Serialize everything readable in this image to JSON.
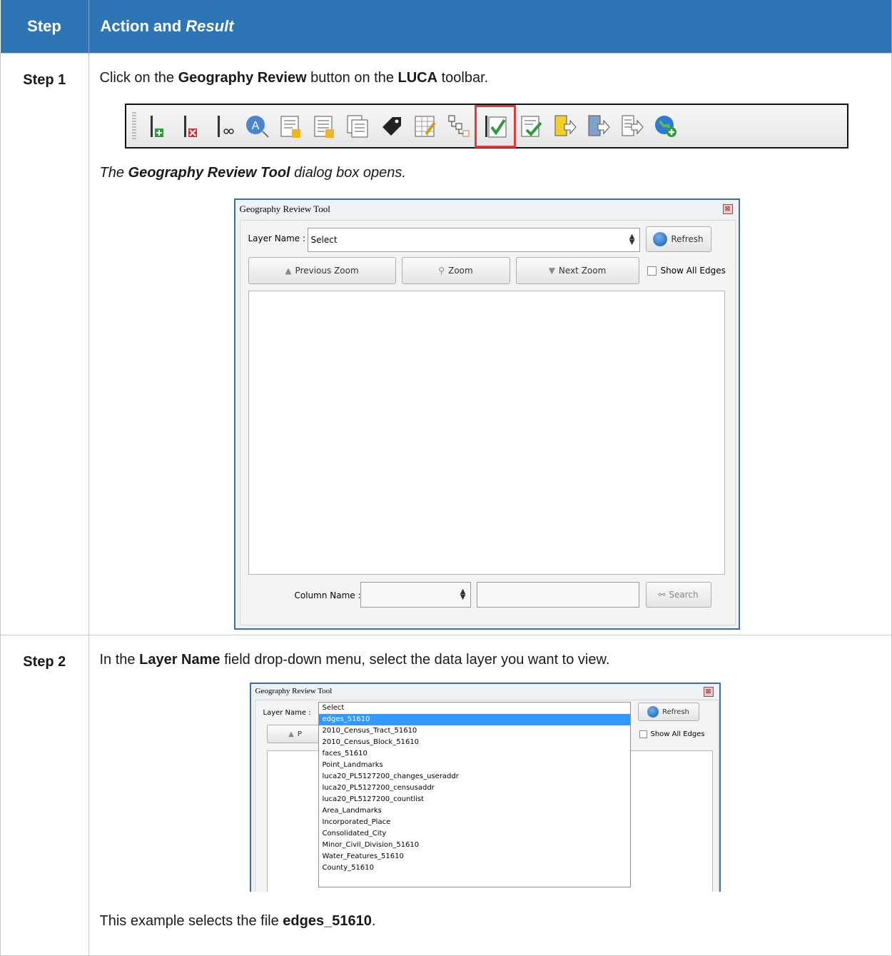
{
  "header": {
    "step_col": "Step",
    "action_col_prefix": "Action and ",
    "action_col_italic": "Result"
  },
  "step1": {
    "label": "Step 1",
    "instruction_pre": "Click on the ",
    "instruction_b1": "Geography Review",
    "instruction_mid": " button on the ",
    "instruction_b2": "LUCA",
    "instruction_post": " toolbar.",
    "result_pre": "The ",
    "result_b": "Geography Review Tool",
    "result_post": " dialog box opens.",
    "toolbar_icons": [
      "add-point-icon",
      "delete-point-icon",
      "split-line-icon",
      "address-label-icon",
      "form-new-icon",
      "form-list-icon",
      "copy-pages-icon",
      "tag-icon",
      "edit-table-icon",
      "structure-icon",
      "geography-review-icon",
      "check-form-icon",
      "export-yellow-icon",
      "export-map-icon",
      "export-list-icon",
      "add-globe-icon"
    ],
    "accent": "#e23b3b",
    "dialog": {
      "title": "Geography Review Tool",
      "close": "⊠",
      "layer_label": "Layer Name :",
      "layer_value": "Select",
      "refresh": "Refresh",
      "prev_zoom": "Previous Zoom",
      "zoom": "Zoom",
      "next_zoom": "Next Zoom",
      "show_all_edges": "Show All Edges",
      "column_label": "Column Name :",
      "search": "Search"
    }
  },
  "step2": {
    "label": "Step 2",
    "instruction_pre": "In the ",
    "instruction_b1": "Layer Name",
    "instruction_post": " field drop-down menu, select the data layer you want to view.",
    "dialog": {
      "title": "Geography Review Tool",
      "close": "⊠",
      "layer_label": "Layer Name :",
      "refresh": "Refresh",
      "prev_zoom_partial": "P",
      "show_all_edges": "Show All Edges",
      "options": [
        "Select",
        "edges_51610",
        "2010_Census_Tract_51610",
        "2010_Census_Block_51610",
        "faces_51610",
        "Point_Landmarks",
        "luca20_PL5127200_changes_useraddr",
        "luca20_PL5127200_censusaddr",
        "luca20_PL5127200_countlist",
        "Area_Landmarks",
        "Incorporated_Place",
        "Consolidated_City",
        "Minor_Civil_Division_51610",
        "Water_Features_51610",
        "County_51610"
      ],
      "selected_option": "edges_51610"
    },
    "note_pre": "This example selects the file ",
    "note_b": "edges_51610",
    "note_post": "."
  },
  "colors": {
    "header_bg": "#2e75b6",
    "dialog_border": "#3a6ea5",
    "selection": "#3399ff"
  }
}
